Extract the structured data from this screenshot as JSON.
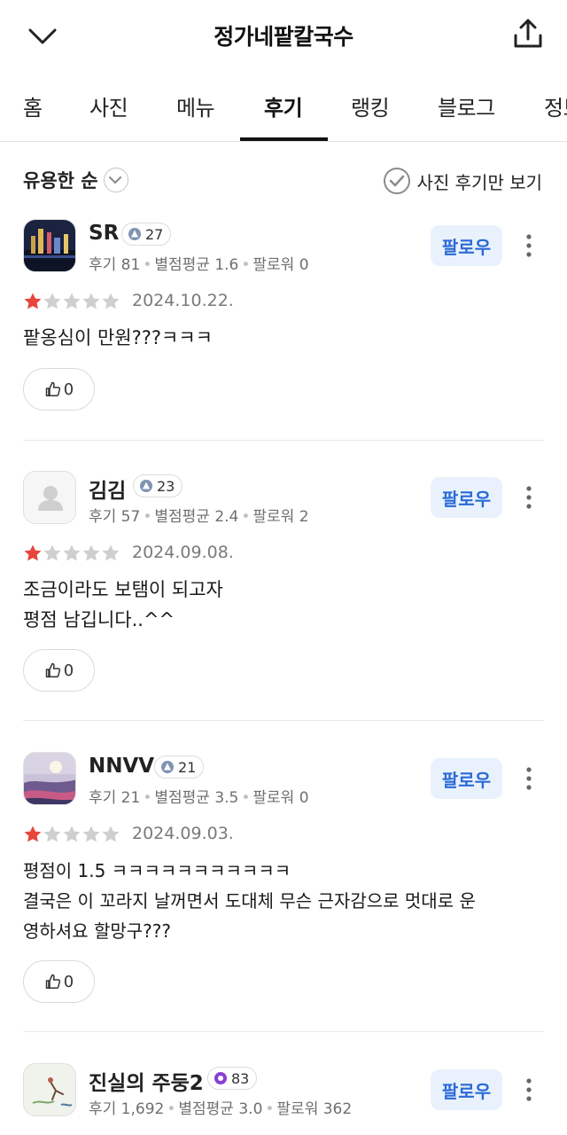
{
  "header": {
    "title": "정가네팥칼국수"
  },
  "tabs": [
    {
      "label": "홈"
    },
    {
      "label": "사진"
    },
    {
      "label": "메뉴"
    },
    {
      "label": "후기",
      "active": true
    },
    {
      "label": "랭킹"
    },
    {
      "label": "블로그"
    },
    {
      "label": "정보"
    }
  ],
  "sort": {
    "label": "유용한 순",
    "photo_only_label": "사진 후기만 보기"
  },
  "colors": {
    "follow_text": "#2a6bd6",
    "follow_bg": "#e9f1fc",
    "star_filled": "#e8453c",
    "star_empty": "#cfcfcf"
  },
  "reviews": [
    {
      "name": "SR",
      "level": "27",
      "level_color": "#7f93b3",
      "reviews_label": "후기 81",
      "avg_label": "별점평균 1.6",
      "followers_label": "팔로워 0",
      "follow_label": "팔로우",
      "rating": 1,
      "date": "2024.10.22.",
      "content": "팥옹심이 만원???ㅋㅋㅋ",
      "likes": "0",
      "avatar_icon": "night-city-photo"
    },
    {
      "name": "김김",
      "level": "23",
      "level_color": "#7f93b3",
      "reviews_label": "후기 57",
      "avg_label": "별점평균 2.4",
      "followers_label": "팔로워 2",
      "follow_label": "팔로우",
      "rating": 1,
      "date": "2024.09.08.",
      "content": "조금이라도 보탬이 되고자\n평점 남깁니다..^^",
      "likes": "0",
      "avatar_icon": "default-person-icon"
    },
    {
      "name": "NNVV",
      "level": "21",
      "level_color": "#7f93b3",
      "reviews_label": "후기 21",
      "avg_label": "별점평균 3.5",
      "followers_label": "팔로워 0",
      "follow_label": "팔로우",
      "rating": 1,
      "date": "2024.09.03.",
      "content": "평점이 1.5 ㅋㅋㅋㅋㅋㅋㅋㅋㅋㅋㅋ\n결국은 이 꼬라지 날꺼면서 도대체 무슨 근자감으로 멋대로 운\n영하셔요 할망구???",
      "likes": "0",
      "avatar_icon": "sunset-photo"
    },
    {
      "name": "진실의 주둥2",
      "level": "83",
      "level_color": "#8a3fd1",
      "reviews_label": "후기 1,692",
      "avg_label": "별점평균 3.0",
      "followers_label": "팔로워 362",
      "follow_label": "팔로우",
      "avatar_icon": "drawing-photo"
    }
  ]
}
